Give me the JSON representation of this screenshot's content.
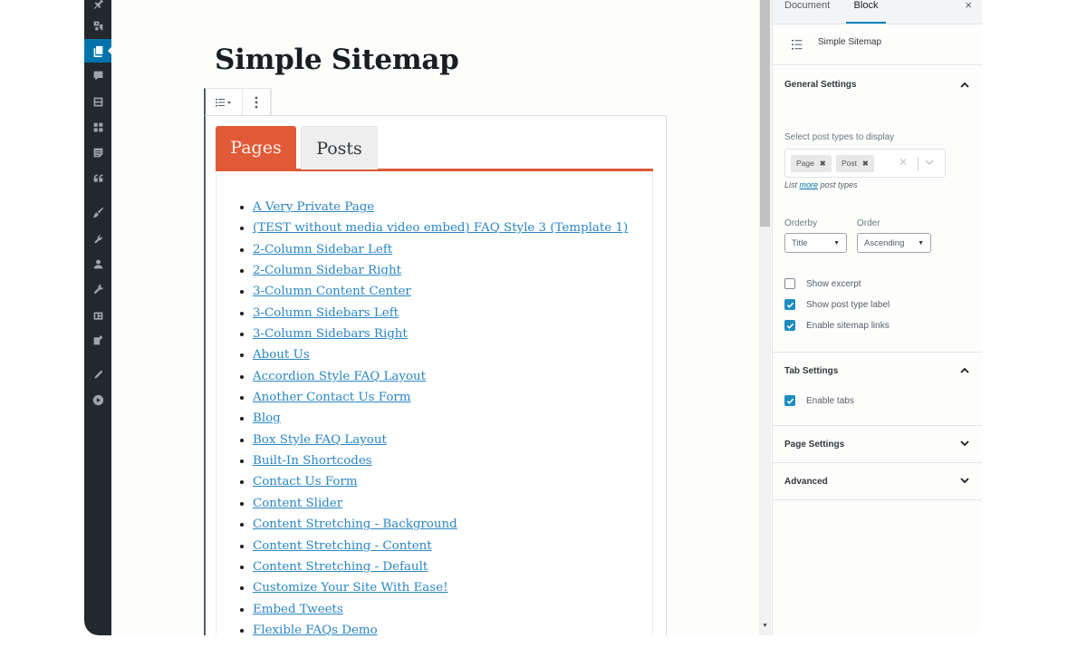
{
  "admin_menu": {
    "items": [
      {
        "name": "pin-icon",
        "active": false
      },
      {
        "name": "media-icon",
        "active": false
      },
      {
        "name": "pages-icon",
        "active": true
      },
      {
        "name": "comments-icon",
        "active": false
      },
      {
        "name": "forms-icon",
        "active": false
      },
      {
        "name": "grid-icon",
        "active": false
      },
      {
        "name": "document-icon",
        "active": false
      },
      {
        "name": "quote-icon",
        "active": false
      },
      {
        "name": "appearance-icon",
        "active": false
      },
      {
        "name": "plugins-icon",
        "active": false
      },
      {
        "name": "users-icon",
        "active": false
      },
      {
        "name": "tools-icon",
        "active": false
      },
      {
        "name": "settings-icon",
        "active": false
      },
      {
        "name": "edit-page-icon",
        "active": false
      },
      {
        "name": "pencil-icon",
        "active": false
      },
      {
        "name": "play-icon",
        "active": false
      }
    ]
  },
  "editor": {
    "post_title": "Simple Sitemap",
    "toolbar": {
      "block_type_icon": "list-icon",
      "more_icon": "more-vertical-icon"
    },
    "tabs": [
      {
        "label": "Pages",
        "active": true
      },
      {
        "label": "Posts",
        "active": false
      }
    ],
    "pages": [
      " A Very Private Page",
      "(TEST without media video embed) FAQ Style 3 (Template 1)",
      "2-Column Sidebar Left",
      "2-Column Sidebar Right",
      "3-Column Content Center",
      "3-Column Sidebars Left",
      "3-Column Sidebars Right",
      "About Us",
      "Accordion Style FAQ Layout",
      "Another Contact Us Form",
      "Blog",
      "Box Style FAQ Layout",
      "Built-In Shortcodes",
      "Contact Us Form",
      "Content Slider",
      "Content Stretching - Background",
      "Content Stretching - Content",
      "Content Stretching - Default",
      "Customize Your Site With Ease!",
      "Embed Tweets",
      "Flexible FAQs Demo"
    ]
  },
  "sidebar": {
    "tabs": [
      {
        "label": "Document",
        "active": false
      },
      {
        "label": "Block",
        "active": true
      }
    ],
    "close_label": "×",
    "block_name": "Simple Sitemap",
    "general_settings": {
      "title": "General Settings",
      "expanded": true,
      "post_types_label": "Select post types to display",
      "selected_post_types": [
        "Page",
        "Post"
      ],
      "chip_remove": "✖",
      "clear_label": "✕",
      "help_prefix": "List ",
      "help_link": "more",
      "help_suffix": " post types",
      "orderby_label": "Orderby",
      "orderby_value": "Title",
      "order_label": "Order",
      "order_value": "Ascending",
      "checkboxes": [
        {
          "label": "Show excerpt",
          "checked": false
        },
        {
          "label": "Show post type label",
          "checked": true
        },
        {
          "label": "Enable sitemap links",
          "checked": true
        }
      ]
    },
    "tab_settings": {
      "title": "Tab Settings",
      "expanded": true,
      "checkboxes": [
        {
          "label": "Enable tabs",
          "checked": true
        }
      ]
    },
    "page_settings": {
      "title": "Page Settings",
      "expanded": false
    },
    "advanced": {
      "title": "Advanced",
      "expanded": false
    }
  },
  "colors": {
    "tab_accent": "#e05a37",
    "link": "#2a86c4",
    "admin_bg": "#23282d",
    "admin_active": "#0073aa",
    "checkbox": "#1e8cbe"
  }
}
